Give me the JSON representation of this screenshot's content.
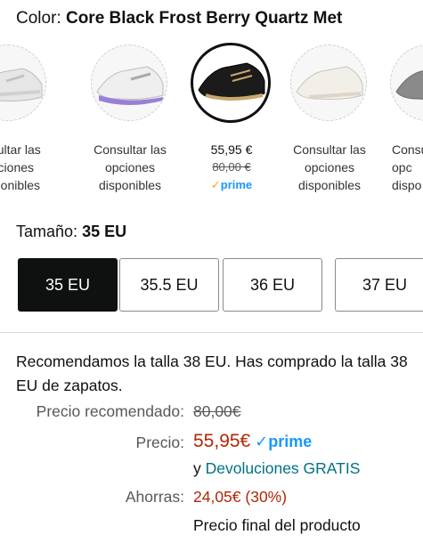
{
  "color": {
    "label": "Color:",
    "value": "Core Black Frost Berry Quartz Met"
  },
  "swatches": [
    {
      "line1": "onsultar las",
      "line2": "opciones",
      "line3": "disponibles"
    },
    {
      "line1": "Consultar las",
      "line2": "opciones",
      "line3": "disponibles"
    },
    {
      "price": "55,95 €",
      "old_price": "80,00 €",
      "prime_check": "✓",
      "prime_text": "prime"
    },
    {
      "line1": "Consultar las",
      "line2": "opciones",
      "line3": "disponibles"
    },
    {
      "line1": "Consu",
      "line2": "opc",
      "line3": "dispo"
    }
  ],
  "size": {
    "label": "Tamaño:",
    "value": "35 EU",
    "options": [
      "35 EU",
      "35.5 EU",
      "36 EU",
      "37 EU"
    ]
  },
  "recommendation": "Recomendamos la talla 38 EU. Has comprado la talla 38 EU de zapatos.",
  "pricing": {
    "rec_label": "Precio recomendado:",
    "rec_value": "80,00€",
    "price_label": "Precio:",
    "price_value": "55,95€",
    "prime_check": "✓",
    "prime_text": "prime",
    "returns_prefix": "y ",
    "returns_link": "Devoluciones GRATIS",
    "savings_label": "Ahorras:",
    "savings_value": "24,05€ (30%)",
    "final_note": "Precio final del producto"
  },
  "colors": {
    "price_red": "#b12704",
    "link_teal": "#007185",
    "prime_blue": "#1a98ff",
    "prime_check_orange": "#f5a623",
    "selected_bg": "#0f1111"
  }
}
